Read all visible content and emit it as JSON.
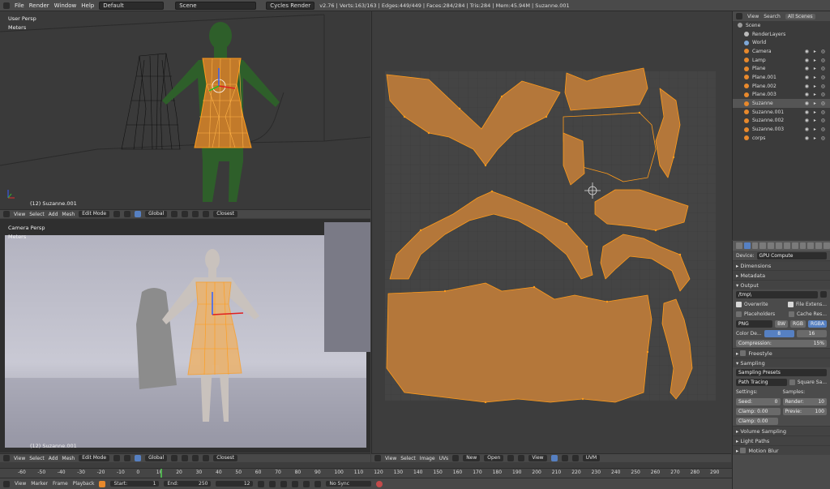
{
  "topbar": {
    "menus": [
      "File",
      "Render",
      "Window",
      "Help"
    ],
    "layout": "Default",
    "scene": "Scene",
    "engine": "Cycles Render",
    "info": "v2.76 | Verts:163/163 | Edges:449/449 | Faces:284/284 | Tris:284 | Mem:45.94M | Suzanne.001"
  },
  "viewport_top": {
    "view_label": "User Persp",
    "units_label": "Meters",
    "object_label": "(12) Suzanne.001"
  },
  "viewport_bottom": {
    "view_label": "Camera Persp",
    "units_label": "Meters",
    "object_label": "(12) Suzanne.001"
  },
  "view3d_header": {
    "view": "View",
    "select": "Select",
    "add": "Add",
    "mesh": "Mesh",
    "mode": "Edit Mode",
    "orientation": "Global",
    "snap": "Closest"
  },
  "uv_header": {
    "view": "View",
    "select": "Select",
    "image": "Image",
    "uvs": "UVs",
    "new": "New",
    "open": "Open",
    "view2": "View",
    "uvmap": "UVM"
  },
  "outliner": {
    "tabs": [
      "View",
      "Search",
      "All Scenes"
    ],
    "items": [
      {
        "label": "Scene",
        "indent": 0
      },
      {
        "label": "RenderLayers",
        "indent": 1
      },
      {
        "label": "World",
        "indent": 1
      },
      {
        "label": "Camera",
        "indent": 1
      },
      {
        "label": "Lamp",
        "indent": 1
      },
      {
        "label": "Plane",
        "indent": 1
      },
      {
        "label": "Plane.001",
        "indent": 1
      },
      {
        "label": "Plane.002",
        "indent": 1
      },
      {
        "label": "Plane.003",
        "indent": 1
      },
      {
        "label": "Suzanne",
        "indent": 1
      },
      {
        "label": "Suzanne.001",
        "indent": 1
      },
      {
        "label": "Suzanne.002",
        "indent": 1
      },
      {
        "label": "Suzanne.003",
        "indent": 1
      },
      {
        "label": "corps",
        "indent": 1
      }
    ]
  },
  "properties": {
    "device_label": "Device:",
    "device_value": "GPU Compute",
    "dimensions": "Dimensions",
    "metadata": "Metadata",
    "output": "Output",
    "output_path": "/tmp\\",
    "overwrite": "Overwrite",
    "file_extensions": "File Extens...",
    "placeholders": "Placeholders",
    "cache_result": "Cache Res...",
    "format": "PNG",
    "bw": "BW",
    "rgb": "RGB",
    "rgba": "RGBA",
    "color_depth_label": "Color De...",
    "color_depth_8": "8",
    "color_depth_16": "16",
    "compression": "Compression:",
    "compression_value": "15%",
    "freestyle": "Freestyle",
    "sampling": "Sampling",
    "sampling_presets": "Sampling Presets",
    "path_tracing": "Path Tracing",
    "square_samples": "Square Sa...",
    "settings": "Settings:",
    "samples": "Samples:",
    "seed": "Seed:",
    "seed_value": "0",
    "render_label": "Render:",
    "render_value": "10",
    "clamp1": "Clamp: 0.00",
    "preview_label": "Previe:",
    "preview_value": "100",
    "clamp2": "Clamp: 0.00",
    "volume_sampling": "Volume Sampling",
    "light_paths": "Light Paths",
    "motion_blur": "Motion Blur"
  },
  "timeline": {
    "numbers": [
      "-60",
      "-50",
      "-40",
      "-30",
      "-20",
      "-10",
      "0",
      "10",
      "20",
      "30",
      "40",
      "50",
      "60",
      "70",
      "80",
      "90",
      "100",
      "110",
      "120",
      "130",
      "140",
      "150",
      "160",
      "170",
      "180",
      "190",
      "200",
      "210",
      "220",
      "230",
      "240",
      "250",
      "260",
      "270",
      "280",
      "290"
    ],
    "view": "View",
    "marker": "Marker",
    "frame": "Frame",
    "playback": "Playback",
    "start": "Start:",
    "start_value": "1",
    "end": "End:",
    "end_value": "250",
    "current_frame": "12",
    "sync": "No Sync"
  },
  "colors": {
    "uv_fill": "#b4773a",
    "uv_edge": "#ff9b1a",
    "selected_blue": "#5680c2"
  }
}
